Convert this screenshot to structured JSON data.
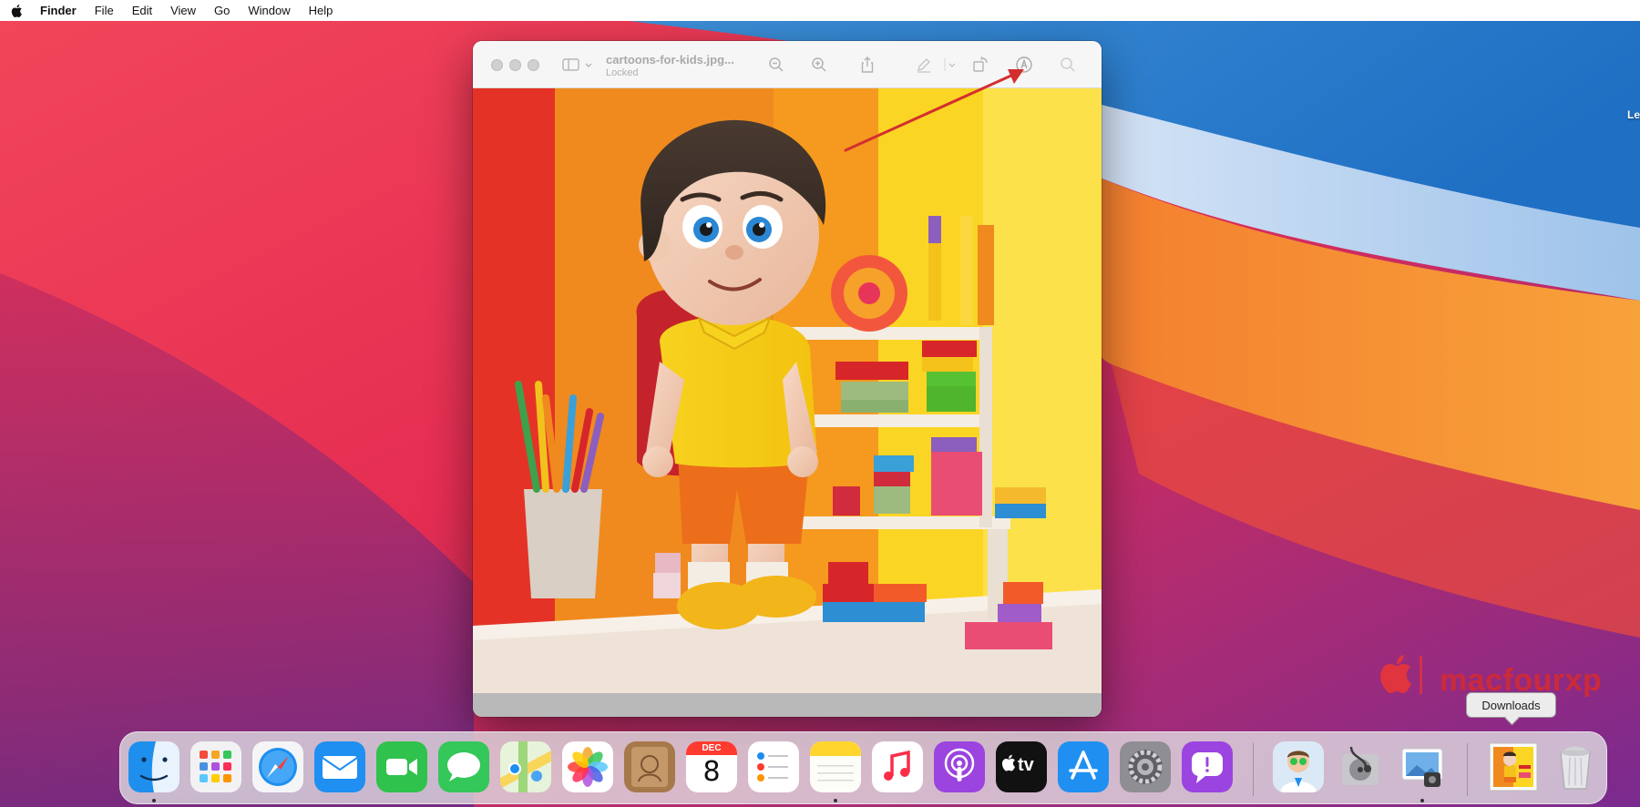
{
  "menubar": {
    "app_name": "Finder",
    "items": [
      "File",
      "Edit",
      "View",
      "Go",
      "Window",
      "Help"
    ]
  },
  "window": {
    "title": "cartoons-for-kids.jpg...",
    "subtitle": "Locked"
  },
  "desktop": {
    "edge_label": "Le"
  },
  "watermark": {
    "text": "macfourxp"
  },
  "tooltip": {
    "text": "Downloads"
  },
  "dock": {
    "calendar_month": "DEC",
    "calendar_day": "8",
    "tv_label": "tv",
    "apps": [
      "finder",
      "launchpad",
      "safari",
      "mail",
      "facetime",
      "messages",
      "maps",
      "photos",
      "contacts",
      "calendar",
      "reminders",
      "notes",
      "music",
      "podcasts",
      "apple-tv",
      "app-store",
      "system-preferences",
      "feedback-assistant",
      "app-doctor",
      "disk-utility",
      "preview",
      "downloads-stack",
      "trash"
    ]
  },
  "colors": {
    "annotation_arrow": "#d32f2f",
    "watermark": "#cc2a3a",
    "menubar_bg": "#ffffff"
  }
}
